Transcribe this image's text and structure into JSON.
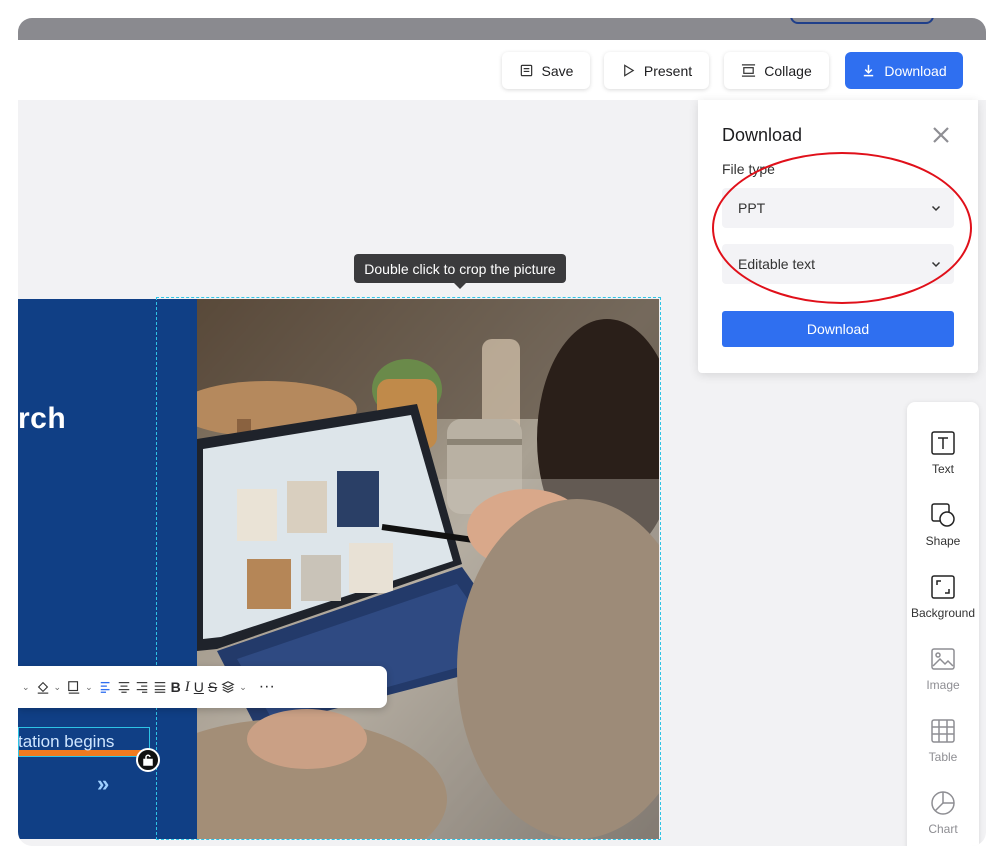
{
  "toolbar": {
    "save": "Save",
    "present": "Present",
    "collage": "Collage",
    "download": "Download"
  },
  "canvas": {
    "tooltip": "Double click to crop the picture",
    "slide_heading_fragment": "rch",
    "textbox_text": "tation begins",
    "chevrons": "»"
  },
  "download_panel": {
    "title": "Download",
    "file_type_label": "File type",
    "file_type_value": "PPT",
    "text_mode_value": "Editable text",
    "download_button": "Download"
  },
  "tools": [
    {
      "label": "Text",
      "icon": "text-icon"
    },
    {
      "label": "Shape",
      "icon": "shape-icon"
    },
    {
      "label": "Background",
      "icon": "background-icon"
    },
    {
      "label": "Image",
      "icon": "image-icon"
    },
    {
      "label": "Table",
      "icon": "table-icon"
    },
    {
      "label": "Chart",
      "icon": "chart-icon"
    }
  ],
  "colors": {
    "accent": "#2f6ff0",
    "slide_blue": "#103f85",
    "annotation_red": "#e0101a",
    "selection_cyan": "#2ec4e6"
  }
}
